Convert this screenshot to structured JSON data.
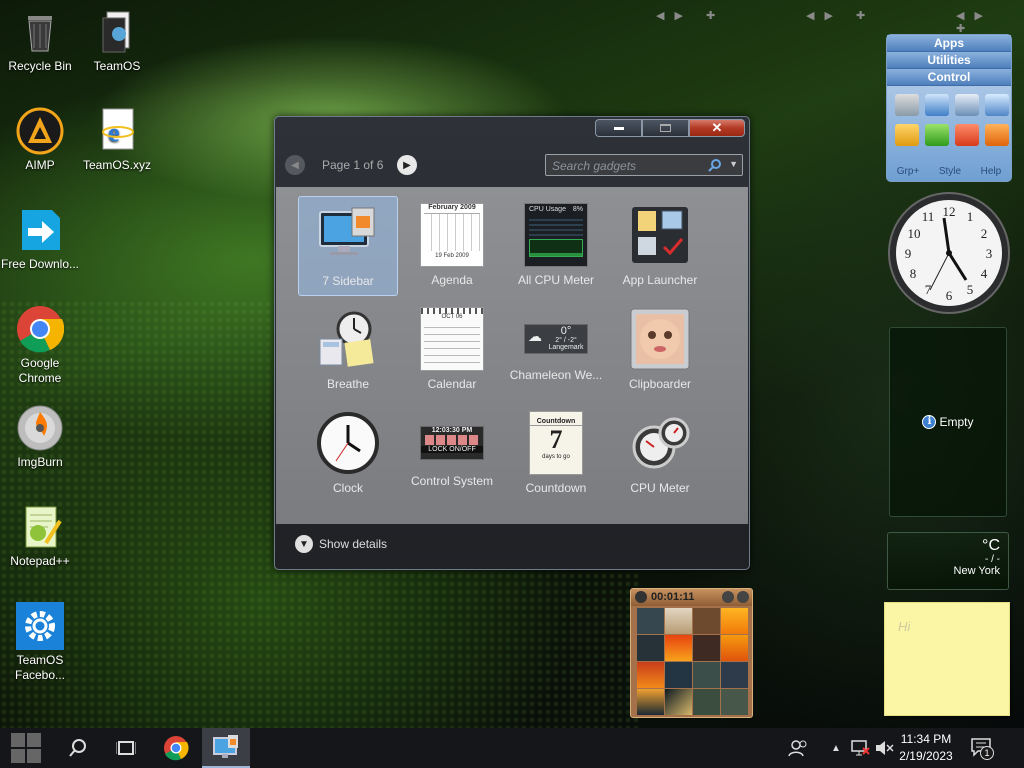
{
  "desktop_icons": [
    {
      "label": "Recycle Bin",
      "icon": "recycle-bin-icon"
    },
    {
      "label": "TeamOS",
      "icon": "teamos-folder-icon"
    },
    {
      "label": "AIMP",
      "icon": "aimp-icon"
    },
    {
      "label": "TeamOS.xyz",
      "icon": "internet-explorer-icon"
    },
    {
      "label": "Free Downlo...",
      "icon": "free-download-manager-icon"
    },
    {
      "label": "Google Chrome",
      "icon": "chrome-icon"
    },
    {
      "label": "ImgBurn",
      "icon": "imgburn-icon"
    },
    {
      "label": "Notepad++",
      "icon": "notepadpp-icon"
    },
    {
      "label": "TeamOS Facebo...",
      "icon": "settings-gear-icon"
    }
  ],
  "gadget_window": {
    "pager": "Page 1 of 6",
    "search_placeholder": "Search gadgets",
    "show_details": "Show details",
    "gadgets": [
      {
        "label": "7 Sidebar",
        "selected": true
      },
      {
        "label": "Agenda"
      },
      {
        "label": "All CPU Meter"
      },
      {
        "label": "App Launcher"
      },
      {
        "label": "Breathe"
      },
      {
        "label": "Calendar"
      },
      {
        "label": "Chameleon We..."
      },
      {
        "label": "Clipboarder"
      },
      {
        "label": "Clock"
      },
      {
        "label": "Control System"
      },
      {
        "label": "Countdown"
      },
      {
        "label": "CPU Meter"
      }
    ],
    "thumb_text": {
      "agenda_title": "February 2009",
      "agenda_footer": "19 Feb 2009",
      "cpu_title": "CPU Usage",
      "cpu_pct": "8%",
      "cal_month": "OCT 06",
      "weather_temp": "0°",
      "weather_range": "2° / -2°",
      "weather_city": "Langemark",
      "control_time": "12:03:30 PM",
      "control_label": "LOCK ON/OFF",
      "countdown_title": "Countdown",
      "countdown_num": "7",
      "countdown_sub": "days to go"
    }
  },
  "launcher": {
    "tabs": [
      "Apps",
      "Utilities",
      "Control"
    ],
    "footer": [
      "Grp+",
      "Style",
      "Help"
    ]
  },
  "sidebar": {
    "empty_text": "Empty",
    "weather_unit": "°C",
    "weather_value": "- / -",
    "weather_city": "New York",
    "note_text": "Hi",
    "puzzle_timer": "00:01:11"
  },
  "taskbar": {
    "time": "11:34 PM",
    "date": "2/19/2023",
    "notification_count": "1"
  },
  "colors": {
    "accent": "#9cb7d8",
    "close": "#b33a24",
    "note": "#fbf6a6"
  }
}
